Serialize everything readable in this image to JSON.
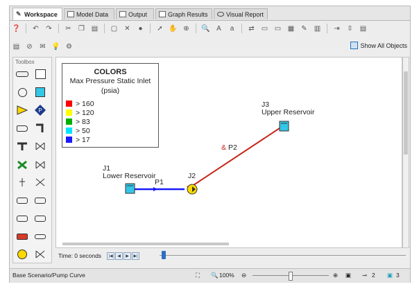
{
  "tabs": [
    {
      "label": "Workspace",
      "active": true
    },
    {
      "label": "Model Data",
      "active": false
    },
    {
      "label": "Output",
      "active": false
    },
    {
      "label": "Graph Results",
      "active": false
    },
    {
      "label": "Visual Report",
      "active": false
    }
  ],
  "toolbar2": {
    "show_all_objects": "Show All Objects"
  },
  "toolbox": {
    "title": "Toolbox"
  },
  "legend": {
    "title": "COLORS",
    "subtitle_line1": "Max Pressure Static Inlet",
    "subtitle_line2": "(psia)",
    "rows": [
      {
        "label": "> 160",
        "color": "#ff0000"
      },
      {
        "label": "> 120",
        "color": "#ffff00"
      },
      {
        "label": "> 83",
        "color": "#00b000"
      },
      {
        "label": "> 50",
        "color": "#00e5ff"
      },
      {
        "label": "> 17",
        "color": "#1a1aff"
      }
    ]
  },
  "network": {
    "j1": {
      "id": "J1",
      "name": "Lower Reservoir"
    },
    "j2": {
      "id": "J2"
    },
    "j3": {
      "id": "J3",
      "name": "Upper Reservoir"
    },
    "p1": {
      "id": "P1"
    },
    "p2": {
      "id": "P2",
      "prefix": "&"
    },
    "colors": {
      "p1": "#1a1aff",
      "p2": "#c8271b",
      "reservoir_fill": "#34c6e6",
      "pump_fill": "#ffd800"
    }
  },
  "timebar": {
    "label": "Time: 0 seconds"
  },
  "status": {
    "scenario": "Base Scenario/Pump Curve",
    "zoom": "100%",
    "pipe_count": "2",
    "junction_count": "3"
  }
}
